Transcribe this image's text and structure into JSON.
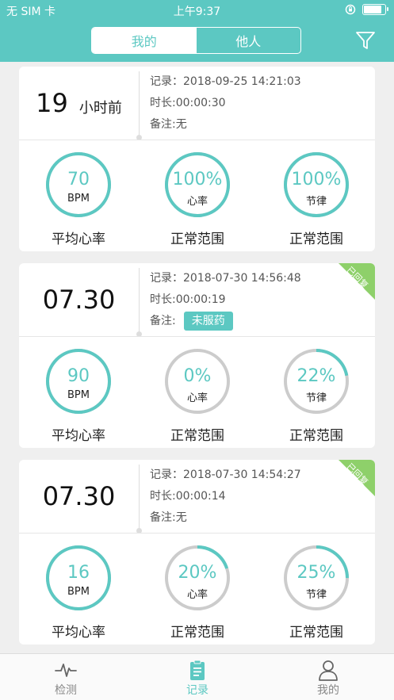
{
  "status_bar": {
    "carrier": "无 SIM 卡",
    "time": "上午9:37"
  },
  "segment": {
    "mine": "我的",
    "others": "他人"
  },
  "records": [
    {
      "date_main": "19",
      "date_suffix": "小时前",
      "record_label": "记录：2018-09-25 14:21:03",
      "duration_label": "时长:00:00:30",
      "note_label": "备注:无",
      "note_tag": "",
      "replied": false,
      "replied_label": "",
      "metrics": [
        {
          "value": "70",
          "sub": "BPM",
          "label": "平均心率",
          "progress": 1.0,
          "color": "#5cc8c2"
        },
        {
          "value": "100%",
          "sub": "心率",
          "label": "正常范围",
          "progress": 1.0,
          "color": "#5cc8c2"
        },
        {
          "value": "100%",
          "sub": "节律",
          "label": "正常范围",
          "progress": 1.0,
          "color": "#5cc8c2"
        }
      ]
    },
    {
      "date_main": "07.30",
      "date_suffix": "",
      "record_label": "记录：2018-07-30 14:56:48",
      "duration_label": "时长:00:00:19",
      "note_label": "备注:",
      "note_tag": "未服药",
      "replied": true,
      "replied_label": "已回复",
      "metrics": [
        {
          "value": "90",
          "sub": "BPM",
          "label": "平均心率",
          "progress": 1.0,
          "color": "#5cc8c2"
        },
        {
          "value": "0%",
          "sub": "心率",
          "label": "正常范围",
          "progress": 0.0,
          "color": "#5cc8c2"
        },
        {
          "value": "22%",
          "sub": "节律",
          "label": "正常范围",
          "progress": 0.22,
          "color": "#5cc8c2"
        }
      ]
    },
    {
      "date_main": "07.30",
      "date_suffix": "",
      "record_label": "记录：2018-07-30 14:54:27",
      "duration_label": "时长:00:00:14",
      "note_label": "备注:无",
      "note_tag": "",
      "replied": true,
      "replied_label": "已回复",
      "metrics": [
        {
          "value": "16",
          "sub": "BPM",
          "label": "平均心率",
          "progress": 1.0,
          "color": "#5cc8c2"
        },
        {
          "value": "20%",
          "sub": "心率",
          "label": "正常范围",
          "progress": 0.2,
          "color": "#5cc8c2"
        },
        {
          "value": "25%",
          "sub": "节律",
          "label": "正常范围",
          "progress": 0.25,
          "color": "#5cc8c2"
        }
      ]
    }
  ],
  "tabbar": {
    "tabs": [
      {
        "label": "检测",
        "icon": "pulse-icon",
        "active": false
      },
      {
        "label": "记录",
        "icon": "clipboard-icon",
        "active": true
      },
      {
        "label": "我的",
        "icon": "person-icon",
        "active": false
      }
    ]
  },
  "colors": {
    "accent": "#5cc8c2",
    "ring_track": "#cccccc",
    "ribbon": "#8ed06a"
  }
}
